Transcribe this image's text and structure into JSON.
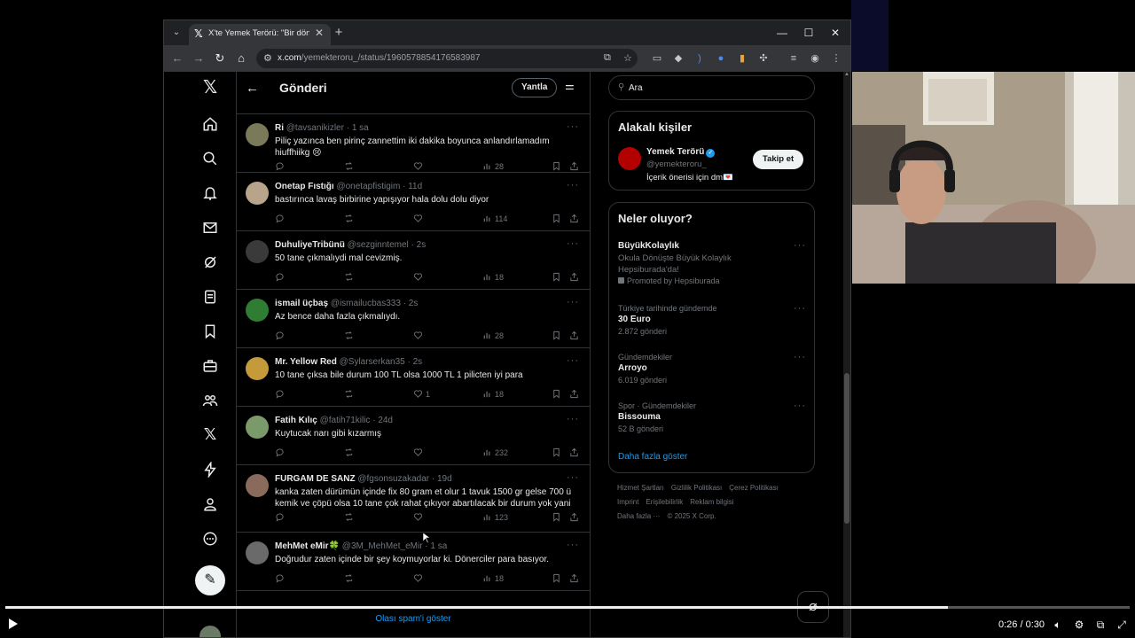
{
  "browser": {
    "tab_title": "X'te Yemek Terörü: \"Bir dönerci",
    "url_host": "x.com",
    "url_path": "/yemekteroru_/status/1960578854176583987"
  },
  "header": {
    "title": "Gönderi",
    "reply_label": "Yantla"
  },
  "tweets": [
    {
      "name": "Ri",
      "handle": "@tavsanikizler",
      "time": "1 sa",
      "text": "Piliç yazınca ben pirinç zannettim iki dakika boyunca anlandırlamadım hiuffhiikg 😢",
      "likes": "",
      "views": "28",
      "avatar_color": "#7a7a5a"
    },
    {
      "name": "Onetap Fıstığı",
      "handle": "@onetapfistigim",
      "time": "11d",
      "text": "bastırınca lavaş birbirine yapışıyor hala dolu dolu diyor",
      "likes": "",
      "views": "114",
      "avatar_color": "#b8a48a"
    },
    {
      "name": "DuhuliyeTribünü",
      "handle": "@sezginntemel",
      "time": "2s",
      "text": "50 tane çıkmalıydi mal cevizmiş.",
      "likes": "",
      "views": "18",
      "avatar_color": "#3a3a3a"
    },
    {
      "name": "ismail üçbaş",
      "handle": "@ismailucbas333",
      "time": "2s",
      "text": "Az bence daha fazla çıkmalıydı.",
      "likes": "",
      "views": "28",
      "avatar_color": "#2e7d32"
    },
    {
      "name": "Mr. Yellow Red",
      "handle": "@Sylarserkan35",
      "time": "2s",
      "text": "10 tane çıksa bile durum 100 TL olsa 1000 TL 1 pilicten iyi para",
      "likes": "1",
      "views": "18",
      "avatar_color": "#c49a3a"
    },
    {
      "name": "Fatih Kılıç",
      "handle": "@fatih71kilic",
      "time": "24d",
      "text": "Kuytucak narı gibi kızarmış",
      "likes": "",
      "views": "232",
      "avatar_color": "#7a9a6a"
    },
    {
      "name": "FURGAM DE SANZ",
      "handle": "@fgsonsuzakadar",
      "time": "19d",
      "text": "kanka zaten dürümün içinde fix 80 gram et olur 1 tavuk 1500 gr gelse 700 ü kemik ve çöpü olsa 10 tane çok rahat çıkıyor abartılacak bir durum yok yani",
      "likes": "",
      "views": "123",
      "avatar_color": "#8a6a5a"
    },
    {
      "name": "MehMet eMir🍀",
      "handle": "@3M_MehMet_eMir",
      "time": "1 sa",
      "text": "Doğrudur zaten içinde bir şey koymuyorlar ki. Dönerciler para basıyor.",
      "likes": "",
      "views": "18",
      "avatar_color": "#6a6a6a"
    }
  ],
  "spam_link": "Olası spam'i göster",
  "sidebar": {
    "search_placeholder": "Ara",
    "related_title": "Alakalı kişiler",
    "person": {
      "name": "Yemek Terörü",
      "handle": "@yemekteroru_",
      "bio": "İçerik önerisi için dm💌",
      "follow_label": "Takip et"
    },
    "trends_title": "Neler oluyor?",
    "trends": [
      {
        "name": "BüyükKolaylık",
        "line1": "Okula Dönüşte Büyük Kolaylık",
        "line2": "Hepsiburada'da!",
        "meta": "Promoted by Hepsiburada"
      },
      {
        "category": "Türkiye tarihinde gündemde",
        "name": "30 Euro",
        "meta": "2.872 gönderi"
      },
      {
        "category": "Gündemdekiler",
        "name": "Arroyo",
        "meta": "6.019 gönderi"
      },
      {
        "category": "Spor · Gündemdekiler",
        "name": "Bissouma",
        "meta": "52 B gönderi"
      }
    ],
    "show_more": "Daha fazla göster",
    "footer": [
      "Hizmet Şartları",
      "Gizlilik Politikası",
      "Çerez Politikası",
      "Imprint",
      "Erişilebilirlik",
      "Reklam bilgisi",
      "Daha fazla ···",
      "© 2025 X Corp."
    ]
  },
  "video": {
    "time": "0:26 / 0:30",
    "progress": 0.838
  },
  "colors": {
    "accent": "#1d9bf0",
    "bg": "#000000",
    "border": "#2f3336",
    "muted": "#71767b"
  }
}
